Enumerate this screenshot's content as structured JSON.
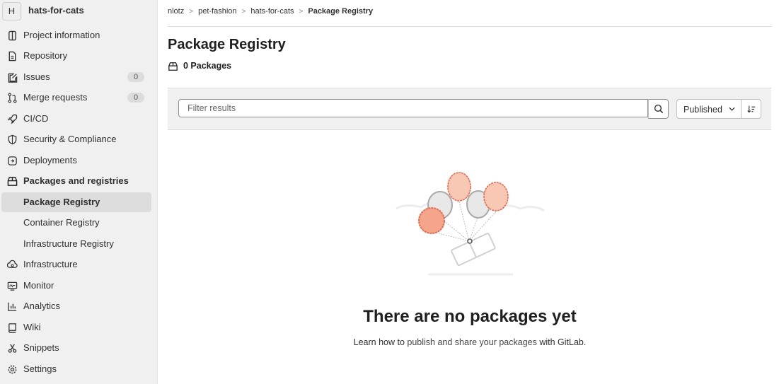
{
  "project": {
    "avatar_letter": "H",
    "name": "hats-for-cats"
  },
  "sidebar": {
    "items": [
      {
        "label": "Project information",
        "icon": "project-info-icon"
      },
      {
        "label": "Repository",
        "icon": "repository-icon"
      },
      {
        "label": "Issues",
        "icon": "issues-icon",
        "badge": "0"
      },
      {
        "label": "Merge requests",
        "icon": "merge-request-icon",
        "badge": "0"
      },
      {
        "label": "CI/CD",
        "icon": "rocket-icon"
      },
      {
        "label": "Security & Compliance",
        "icon": "shield-icon"
      },
      {
        "label": "Deployments",
        "icon": "deployments-icon"
      },
      {
        "label": "Packages and registries",
        "icon": "package-icon"
      },
      {
        "label": "Package Registry"
      },
      {
        "label": "Container Registry"
      },
      {
        "label": "Infrastructure Registry"
      },
      {
        "label": "Infrastructure",
        "icon": "cloud-gear-icon"
      },
      {
        "label": "Monitor",
        "icon": "monitor-icon"
      },
      {
        "label": "Analytics",
        "icon": "chart-icon"
      },
      {
        "label": "Wiki",
        "icon": "book-icon"
      },
      {
        "label": "Snippets",
        "icon": "scissors-icon"
      },
      {
        "label": "Settings",
        "icon": "gear-icon"
      }
    ],
    "active_item": "Package Registry"
  },
  "breadcrumb": {
    "items": [
      "nlotz",
      "pet-fashion",
      "hats-for-cats",
      "Package Registry"
    ]
  },
  "page": {
    "title": "Package Registry",
    "count_text": "0 Packages"
  },
  "filter": {
    "placeholder": "Filter results",
    "sort_selected": "Published"
  },
  "empty_state": {
    "title": "There are no packages yet",
    "desc_prefix": "Learn how to ",
    "desc_link": "publish and share your packages",
    "desc_suffix": " with GitLab."
  },
  "colors": {
    "balloon_orange": "#e9694b",
    "balloon_peach": "#f8c8b4",
    "balloon_grey": "#e8e8e8",
    "sidebar_bg": "#f0f0f0"
  }
}
